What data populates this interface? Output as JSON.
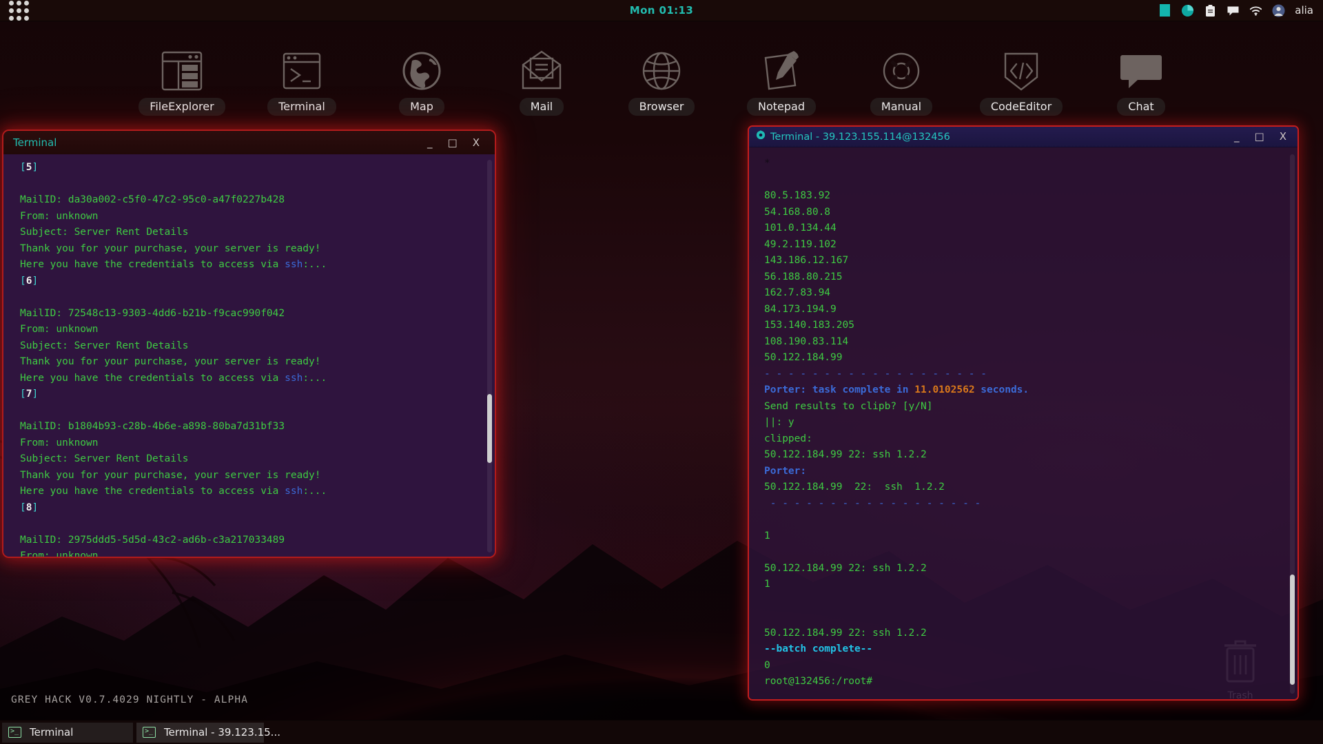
{
  "topbar": {
    "launcher_icon": "app-grid-icon",
    "clock": "Mon 01:13",
    "clock_color": "#22bdb0",
    "tray": [
      {
        "icon": "teal-square-icon",
        "label": ""
      },
      {
        "icon": "pie-chart-icon",
        "label": ""
      },
      {
        "icon": "clipboard-icon",
        "label": ""
      },
      {
        "icon": "chat-bubble-icon",
        "label": ""
      },
      {
        "icon": "wifi-icon",
        "label": ""
      },
      {
        "icon": "user-avatar-icon",
        "label": ""
      }
    ],
    "username": "alia"
  },
  "desktop_icons": [
    {
      "label": "FileExplorer",
      "icon": "file-explorer-icon"
    },
    {
      "label": "Terminal",
      "icon": "terminal-icon"
    },
    {
      "label": "Map",
      "icon": "globe-map-icon"
    },
    {
      "label": "Mail",
      "icon": "envelope-icon"
    },
    {
      "label": "Browser",
      "icon": "globe-wireframe-icon"
    },
    {
      "label": "Notepad",
      "icon": "notepad-pencil-icon"
    },
    {
      "label": "Manual",
      "icon": "life-ring-icon"
    },
    {
      "label": "CodeEditor",
      "icon": "code-brackets-icon"
    },
    {
      "label": "Chat",
      "icon": "speech-bubble-icon"
    }
  ],
  "window_left": {
    "title": "Terminal",
    "controls": {
      "minimize": "_",
      "maximize": "□",
      "close": "X"
    },
    "lines": [
      [
        {
          "t": "[",
          "c": "cyan-br"
        },
        {
          "t": "5",
          "c": "white"
        },
        {
          "t": "]",
          "c": "cyan-br"
        }
      ],
      [],
      [
        {
          "t": "MailID: da30a002-c5f0-47c2-95c0-a47f0227b428",
          "c": "green"
        }
      ],
      [
        {
          "t": "From: unknown",
          "c": "green"
        }
      ],
      [
        {
          "t": "Subject: Server Rent Details",
          "c": "green"
        }
      ],
      [
        {
          "t": "Thank you for your purchase, your server is ready!",
          "c": "green"
        }
      ],
      [
        {
          "t": "Here you have the credentials to access via ",
          "c": "green"
        },
        {
          "t": "ssh",
          "c": "sshblue"
        },
        {
          "t": ":...",
          "c": "green"
        }
      ],
      [
        {
          "t": "[",
          "c": "cyan-br"
        },
        {
          "t": "6",
          "c": "white"
        },
        {
          "t": "]",
          "c": "cyan-br"
        }
      ],
      [],
      [
        {
          "t": "MailID: 72548c13-9303-4dd6-b21b-f9cac990f042",
          "c": "green"
        }
      ],
      [
        {
          "t": "From: unknown",
          "c": "green"
        }
      ],
      [
        {
          "t": "Subject: Server Rent Details",
          "c": "green"
        }
      ],
      [
        {
          "t": "Thank you for your purchase, your server is ready!",
          "c": "green"
        }
      ],
      [
        {
          "t": "Here you have the credentials to access via ",
          "c": "green"
        },
        {
          "t": "ssh",
          "c": "sshblue"
        },
        {
          "t": ":...",
          "c": "green"
        }
      ],
      [
        {
          "t": "[",
          "c": "cyan-br"
        },
        {
          "t": "7",
          "c": "white"
        },
        {
          "t": "]",
          "c": "cyan-br"
        }
      ],
      [],
      [
        {
          "t": "MailID: b1804b93-c28b-4b6e-a898-80ba7d31bf33",
          "c": "green"
        }
      ],
      [
        {
          "t": "From: unknown",
          "c": "green"
        }
      ],
      [
        {
          "t": "Subject: Server Rent Details",
          "c": "green"
        }
      ],
      [
        {
          "t": "Thank you for your purchase, your server is ready!",
          "c": "green"
        }
      ],
      [
        {
          "t": "Here you have the credentials to access via ",
          "c": "green"
        },
        {
          "t": "ssh",
          "c": "sshblue"
        },
        {
          "t": ":...",
          "c": "green"
        }
      ],
      [
        {
          "t": "[",
          "c": "cyan-br"
        },
        {
          "t": "8",
          "c": "white"
        },
        {
          "t": "]",
          "c": "cyan-br"
        }
      ],
      [],
      [
        {
          "t": "MailID: 2975ddd5-5d5d-43c2-ad6b-c3a217033489",
          "c": "green"
        }
      ],
      [
        {
          "t": "From: unknown",
          "c": "green"
        }
      ]
    ]
  },
  "window_right": {
    "title": "Terminal - 39.123.155.114@132456",
    "icon": "gear-icon",
    "controls": {
      "minimize": "_",
      "maximize": "□",
      "close": "X"
    },
    "lines": [
      [
        {
          "t": "*",
          "c": "dark"
        }
      ],
      [],
      [
        {
          "t": "80.5.183.92",
          "c": "green"
        }
      ],
      [
        {
          "t": "54.168.80.8",
          "c": "green"
        }
      ],
      [
        {
          "t": "101.0.134.44",
          "c": "green"
        }
      ],
      [
        {
          "t": "49.2.119.102",
          "c": "green"
        }
      ],
      [
        {
          "t": "143.186.12.167",
          "c": "green"
        }
      ],
      [
        {
          "t": "56.188.80.215",
          "c": "green"
        }
      ],
      [
        {
          "t": "162.7.83.94",
          "c": "green"
        }
      ],
      [
        {
          "t": "84.173.194.9",
          "c": "green"
        }
      ],
      [
        {
          "t": "153.140.183.205",
          "c": "green"
        }
      ],
      [
        {
          "t": "108.190.83.114",
          "c": "green"
        }
      ],
      [
        {
          "t": "50.122.184.99",
          "c": "green"
        }
      ],
      [
        {
          "t": "- - - - - - - - - - - - - - - - - - -",
          "c": "blue"
        }
      ],
      [
        {
          "t": "Porter: task complete in ",
          "c": "blue-b"
        },
        {
          "t": "11.0102562",
          "c": "orange"
        },
        {
          "t": " seconds.",
          "c": "blue-b"
        }
      ],
      [
        {
          "t": "Send results to clipb? [y/N]",
          "c": "green"
        }
      ],
      [
        {
          "t": "||: y",
          "c": "green"
        }
      ],
      [
        {
          "t": "clipped:",
          "c": "green"
        }
      ],
      [
        {
          "t": "50.122.184.99 22: ssh 1.2.2",
          "c": "green"
        }
      ],
      [
        {
          "t": "Porter:",
          "c": "blue-b"
        }
      ],
      [
        {
          "t": "50.122.184.99  22:  ssh  1.2.2",
          "c": "green"
        }
      ],
      [
        {
          "t": " - - - - - - - - - - - - - - - - - -",
          "c": "blue"
        }
      ],
      [],
      [
        {
          "t": "1",
          "c": "green"
        }
      ],
      [],
      [
        {
          "t": "50.122.184.99 22: ssh 1.2.2",
          "c": "green"
        }
      ],
      [
        {
          "t": "1",
          "c": "green"
        }
      ],
      [],
      [],
      [
        {
          "t": "50.122.184.99 22: ssh 1.2.2",
          "c": "green"
        }
      ],
      [
        {
          "t": "--batch complete--",
          "c": "cyan"
        }
      ],
      [
        {
          "t": "0",
          "c": "green"
        }
      ],
      [
        {
          "t": "root@132456:/root#",
          "c": "green"
        }
      ]
    ]
  },
  "desktop": {
    "trash_label": "Trash",
    "version_text": "GREY HACK V0.7.4029 NIGHTLY - ALPHA"
  },
  "taskbar": {
    "items": [
      {
        "label": "Terminal",
        "icon": "terminal-icon"
      },
      {
        "label": "Terminal - 39.123.15...",
        "icon": "terminal-icon"
      }
    ]
  },
  "colors": {
    "accent_teal": "#22bdb0",
    "terminal_green": "#3fcc43",
    "window_red_border": "#c51d1d",
    "porter_blue": "#3b6bd8",
    "highlight_orange": "#d9781b",
    "batch_cyan": "#22c3e6"
  }
}
